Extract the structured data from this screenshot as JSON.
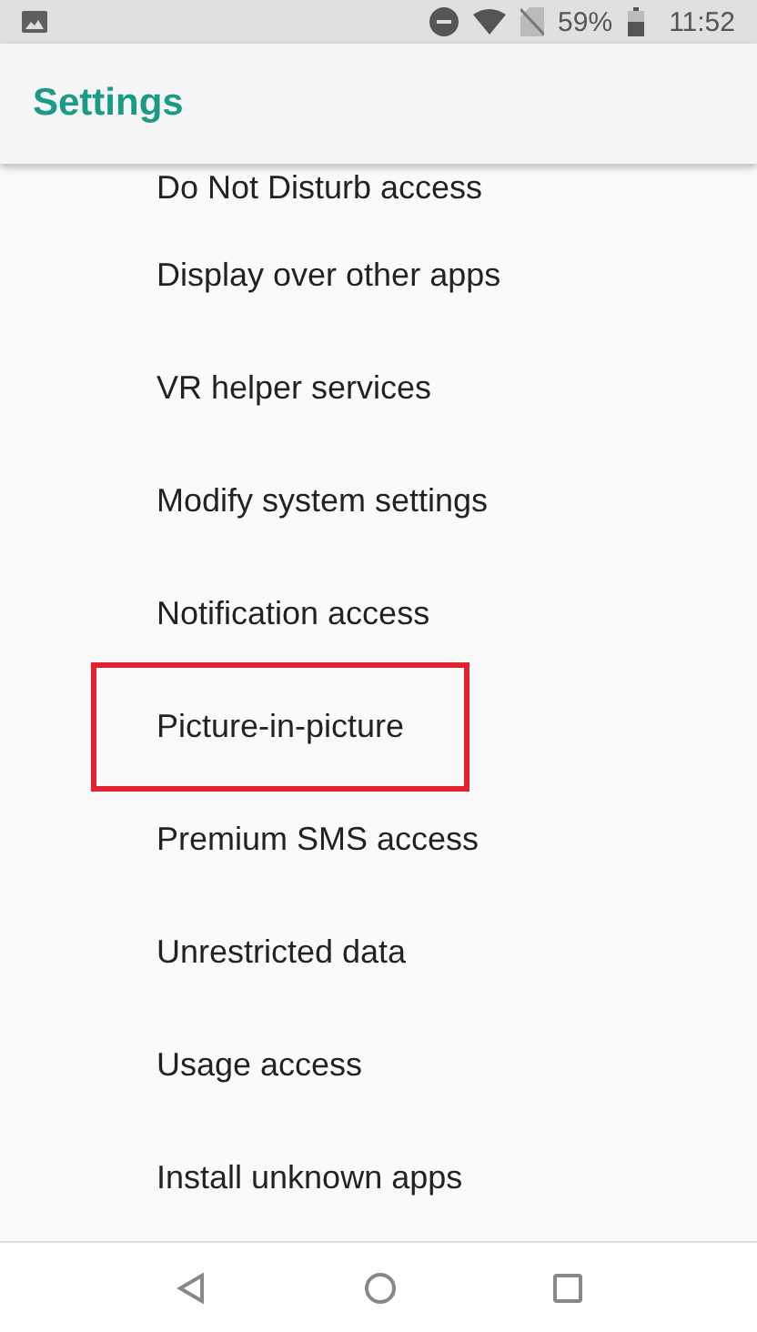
{
  "status_bar": {
    "battery": "59%",
    "time": "11:52"
  },
  "app_bar": {
    "title": "Settings"
  },
  "items": [
    {
      "label": "Do Not Disturb access",
      "highlighted": false
    },
    {
      "label": "Display over other apps",
      "highlighted": false
    },
    {
      "label": "VR helper services",
      "highlighted": false
    },
    {
      "label": "Modify system settings",
      "highlighted": false
    },
    {
      "label": "Notification access",
      "highlighted": false
    },
    {
      "label": "Picture-in-picture",
      "highlighted": true
    },
    {
      "label": "Premium SMS access",
      "highlighted": false
    },
    {
      "label": "Unrestricted data",
      "highlighted": false
    },
    {
      "label": "Usage access",
      "highlighted": false
    },
    {
      "label": "Install unknown apps",
      "highlighted": false
    }
  ]
}
